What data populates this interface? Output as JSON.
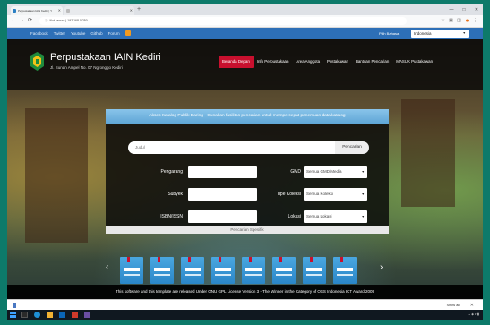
{
  "browser": {
    "tabs": [
      {
        "title": "Perpustakaan IAIN Kediri | Y",
        "active": true
      },
      {
        "title": "",
        "active": false
      }
    ],
    "new_tab_label": "+",
    "window_controls": [
      "—",
      "□",
      "✕"
    ],
    "nav_buttons": [
      "←",
      "→",
      "⟳"
    ],
    "url": "192.168.0.250",
    "security_label": "Not secure"
  },
  "topbar": {
    "links": [
      "Facebook",
      "Twitter",
      "Youtube",
      "Github",
      "Forum"
    ],
    "language_label": "Pilih Bahasa",
    "language_selected": "Indonesia"
  },
  "header": {
    "title": "Perpustakaan IAIN Kediri",
    "address": "Jl. Sunan Ampel No. 07 Ngronggo Kediri",
    "nav": [
      "Beranda Depan",
      "Info Perpustakaan",
      "Area Anggota",
      "Pustakawan",
      "Bantuan Pencarian",
      "MASUK Pustakawan"
    ],
    "active_nav": 0
  },
  "search_panel": {
    "heading": "Akses Katalog Publik Daring - Gunakan fasilitas pencarian untuk mempercepat penemuan data katalog",
    "keyword_placeholder": "Judul",
    "search_button": "Pencarian",
    "labels": {
      "author": "Pengarang",
      "subject": "Subyek",
      "isbn": "ISBN/ISSN",
      "gmd": "GMD",
      "collection_type": "Tipe Koleksi",
      "location": "Lokasi"
    },
    "selects": {
      "gmd": "Semua GMD/Media",
      "collection_type": "Semua Koleksi",
      "location": "Semua Lokasi"
    },
    "specific_search": "Pencarian Spesifik"
  },
  "footer": {
    "text": "This software and this template are released Under GNU GPL License Version 3 - The Winner in the Category of OSS Indonesia ICT Award 2009"
  },
  "downloads": {
    "show_all": "Show all",
    "close": "✕"
  },
  "colors": {
    "topbar": "#2d6fb7",
    "active_nav": "#c8102e",
    "panel_head": "#6fb3e0",
    "book": "#3b98d6",
    "rss": "#f39a1e"
  },
  "icons": [
    "rss-icon",
    "library-logo-icon",
    "book-cover-icon",
    "dropdown-arrow-icon",
    "chrome-icon",
    "start-icon"
  ]
}
